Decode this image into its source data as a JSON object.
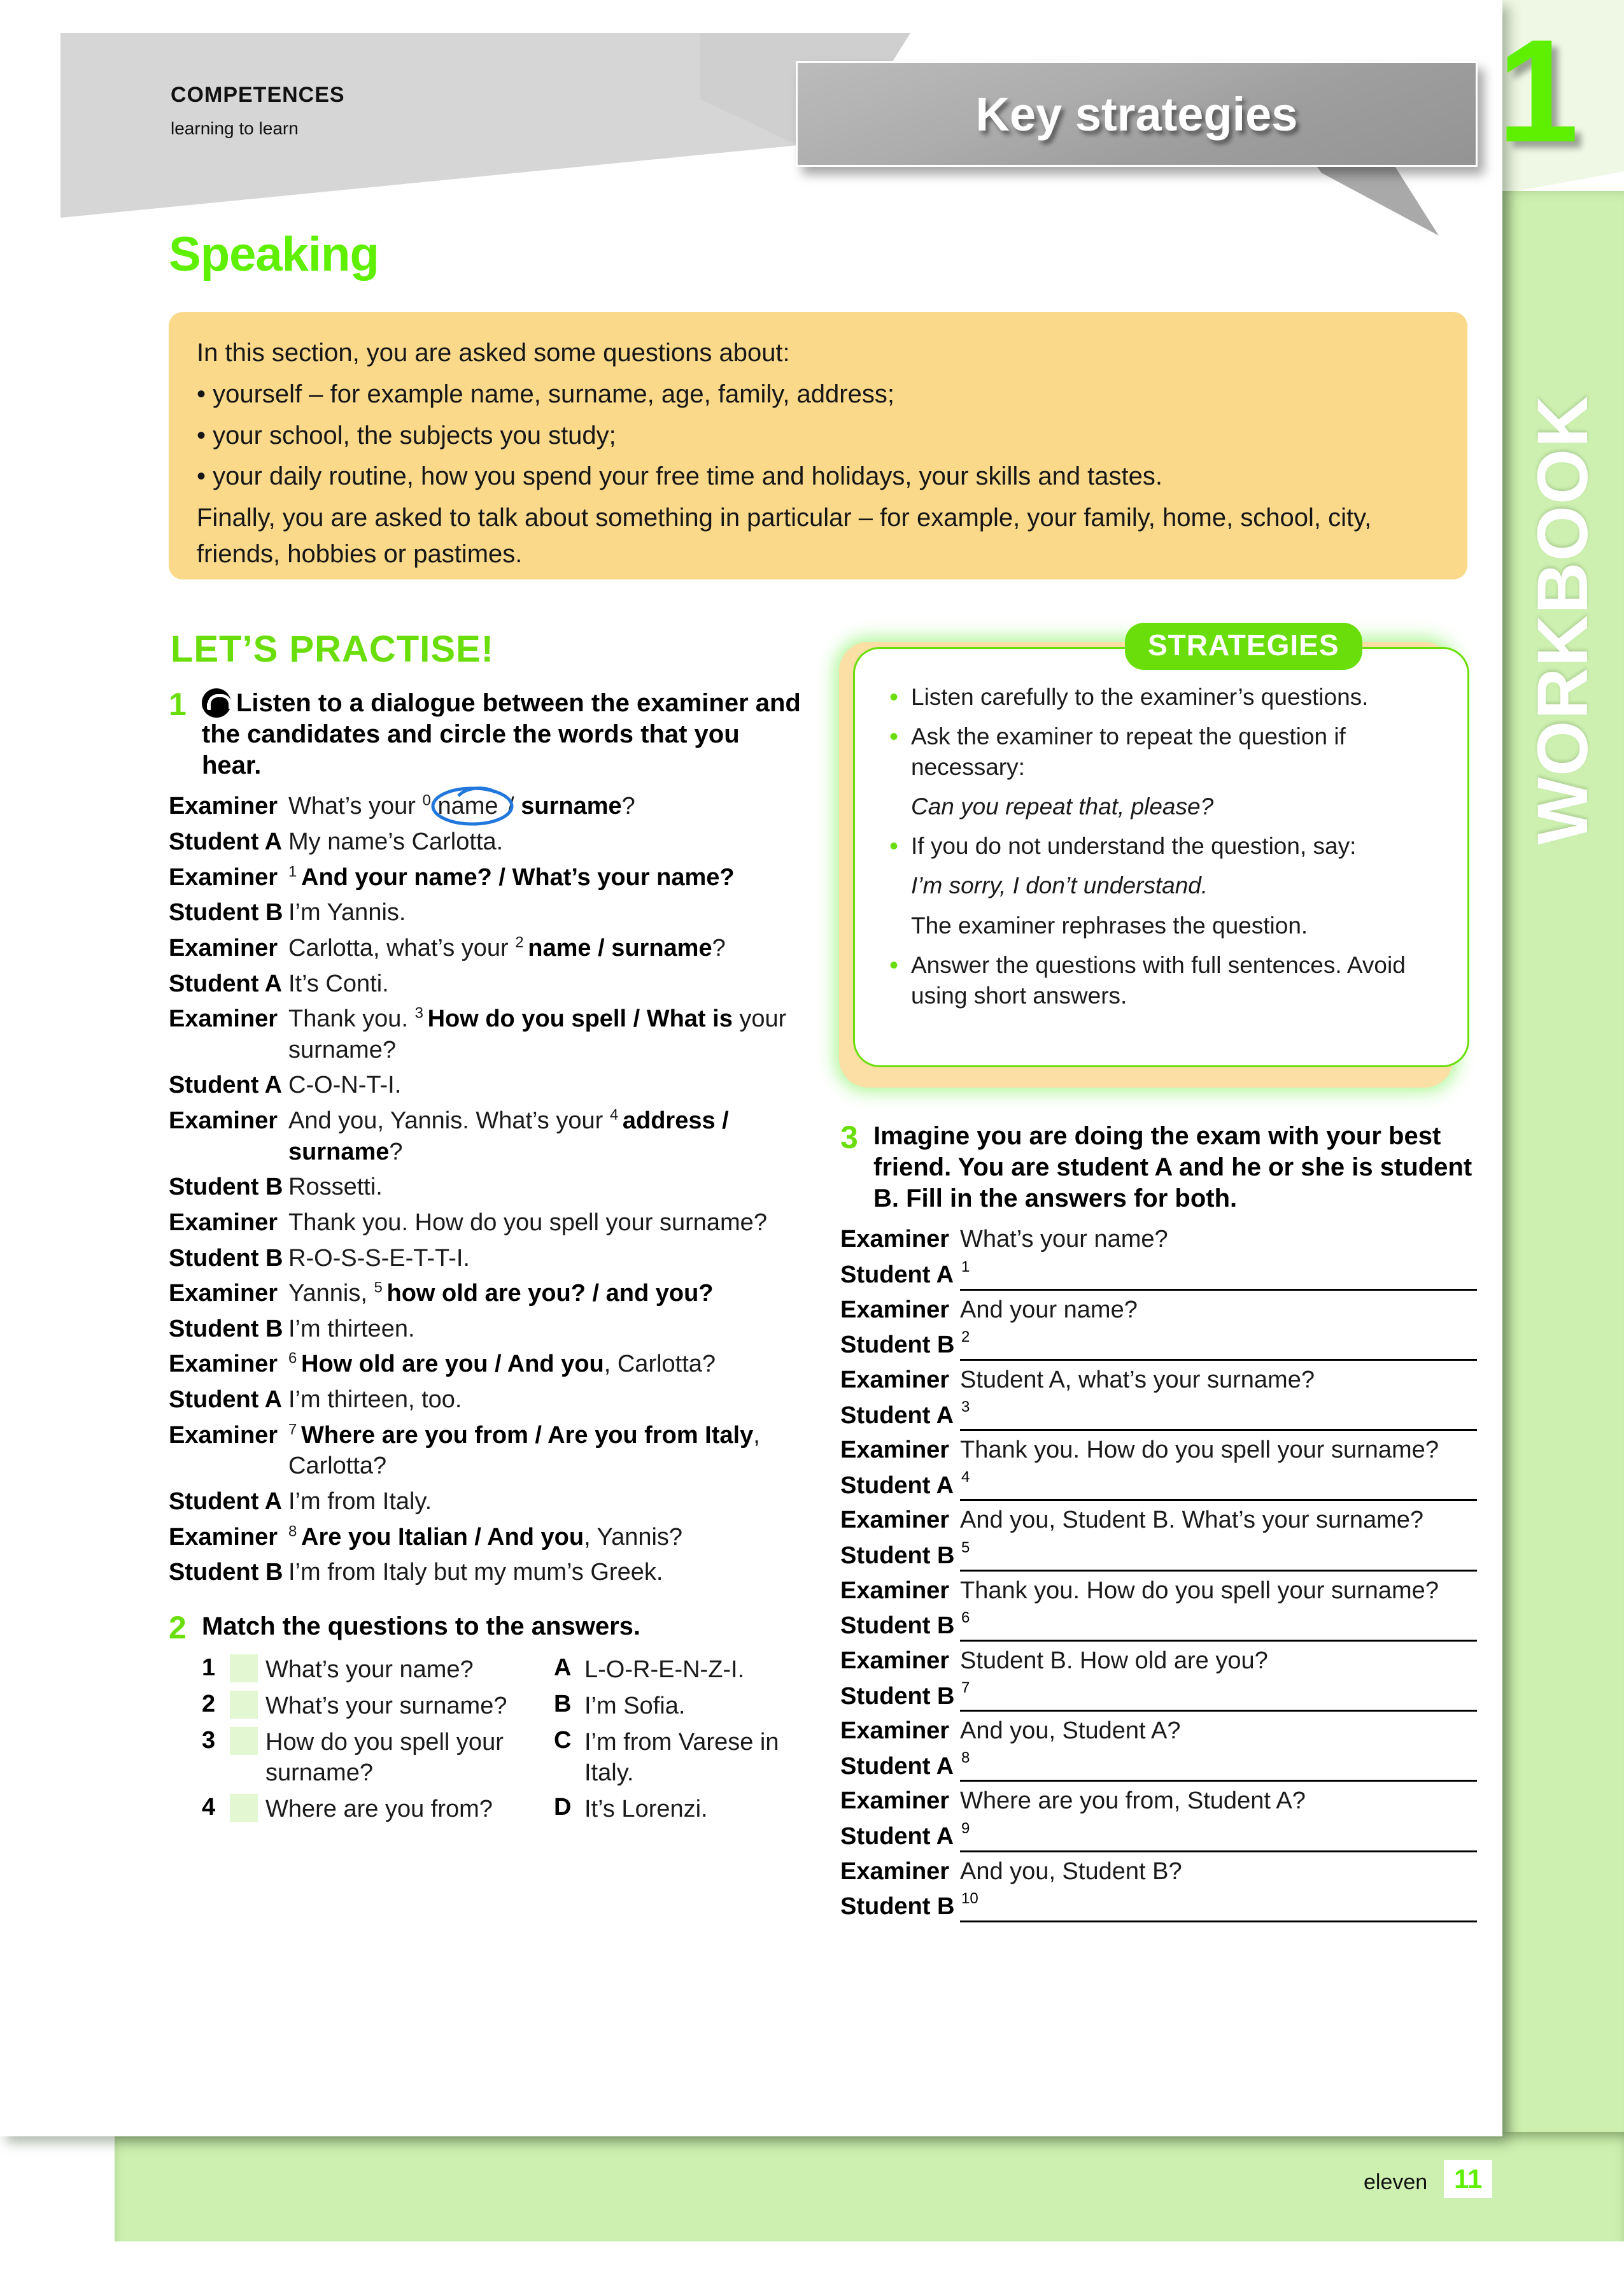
{
  "header": {
    "competences": "COMPETENCES",
    "subtitle": "learning to learn",
    "banner_title": "Key strategies",
    "unit_number": "1",
    "sidebar_label": "WORKBOOK"
  },
  "section": {
    "title": "Speaking",
    "intro": {
      "lead": "In this section, you are asked some questions about:",
      "bullets": [
        "• yourself – for example name, surname, age, family, address;",
        "• your school, the subjects you study;",
        "• your daily routine, how you spend your free time and holidays, your skills and tastes."
      ],
      "closing": "Finally, you are asked to talk about something in particular – for example, your family, home, school, city, friends, hobbies or pastimes."
    },
    "practise_heading": "LET’S PRACTISE!"
  },
  "exercise1": {
    "number": "1",
    "icon": "headphones-icon",
    "instruction": "Listen to a dialogue between the examiner and the candidates and circle the words that you hear.",
    "dialogue": [
      {
        "speaker": "Examiner",
        "parts": [
          {
            "t": "What’s your ",
            "b": false
          },
          {
            "t": "0 ",
            "sup": true
          },
          {
            "t": "name",
            "circled": true
          },
          {
            "t": " / ",
            "b": false
          },
          {
            "t": "surname",
            "b": true
          },
          {
            "t": "?",
            "b": false
          }
        ]
      },
      {
        "speaker": "Student A",
        "parts": [
          {
            "t": "My name’s Carlotta.",
            "b": false
          }
        ]
      },
      {
        "speaker": "Examiner",
        "parts": [
          {
            "t": "1 ",
            "sup": true
          },
          {
            "t": "And your name? / What’s your name?",
            "b": true
          }
        ]
      },
      {
        "speaker": "Student B",
        "parts": [
          {
            "t": "I’m Yannis.",
            "b": false
          }
        ]
      },
      {
        "speaker": "Examiner",
        "parts": [
          {
            "t": "Carlotta, what’s your ",
            "b": false
          },
          {
            "t": "2 ",
            "sup": true
          },
          {
            "t": "name / surname",
            "b": true
          },
          {
            "t": "?",
            "b": false
          }
        ]
      },
      {
        "speaker": "Student A",
        "parts": [
          {
            "t": "It’s Conti.",
            "b": false
          }
        ]
      },
      {
        "speaker": "Examiner",
        "parts": [
          {
            "t": "Thank you. ",
            "b": false
          },
          {
            "t": "3 ",
            "sup": true
          },
          {
            "t": "How do you spell / What is",
            "b": true
          },
          {
            "t": " your surname?",
            "b": false
          }
        ]
      },
      {
        "speaker": "Student A",
        "parts": [
          {
            "t": "C-O-N-T-I.",
            "b": false
          }
        ]
      },
      {
        "speaker": "Examiner",
        "parts": [
          {
            "t": "And you, Yannis. What’s your ",
            "b": false
          },
          {
            "t": "4 ",
            "sup": true
          },
          {
            "t": "address / surname",
            "b": true
          },
          {
            "t": "?",
            "b": false
          }
        ]
      },
      {
        "speaker": "Student B",
        "parts": [
          {
            "t": "Rossetti.",
            "b": false
          }
        ]
      },
      {
        "speaker": "Examiner",
        "parts": [
          {
            "t": "Thank you. How do you spell your surname?",
            "b": false
          }
        ]
      },
      {
        "speaker": "Student B",
        "parts": [
          {
            "t": "R-O-S-S-E-T-T-I.",
            "b": false
          }
        ]
      },
      {
        "speaker": "Examiner",
        "parts": [
          {
            "t": "Yannis, ",
            "b": false
          },
          {
            "t": "5 ",
            "sup": true
          },
          {
            "t": "how old are you? / and you?",
            "b": true
          }
        ]
      },
      {
        "speaker": "Student B",
        "parts": [
          {
            "t": "I’m thirteen.",
            "b": false
          }
        ]
      },
      {
        "speaker": "Examiner",
        "parts": [
          {
            "t": "6 ",
            "sup": true
          },
          {
            "t": "How old are you / And you",
            "b": true
          },
          {
            "t": ", Carlotta?",
            "b": false
          }
        ]
      },
      {
        "speaker": "Student A",
        "parts": [
          {
            "t": "I’m thirteen, too.",
            "b": false
          }
        ]
      },
      {
        "speaker": "Examiner",
        "parts": [
          {
            "t": "7 ",
            "sup": true
          },
          {
            "t": "Where are you from / Are you from Italy",
            "b": true
          },
          {
            "t": ", Carlotta?",
            "b": false
          }
        ]
      },
      {
        "speaker": "Student A",
        "parts": [
          {
            "t": "I’m from Italy.",
            "b": false
          }
        ]
      },
      {
        "speaker": "Examiner",
        "parts": [
          {
            "t": "8 ",
            "sup": true
          },
          {
            "t": "Are you Italian / And you",
            "b": true
          },
          {
            "t": ", Yannis?",
            "b": false
          }
        ]
      },
      {
        "speaker": "Student B",
        "parts": [
          {
            "t": "I’m from Italy but my mum’s Greek.",
            "b": false
          }
        ]
      }
    ]
  },
  "exercise2": {
    "number": "2",
    "instruction": "Match the questions to the answers.",
    "questions": [
      {
        "num": "1",
        "text": "What’s your name?"
      },
      {
        "num": "2",
        "text": "What’s your surname?"
      },
      {
        "num": "3",
        "text": "How do you spell your surname?"
      },
      {
        "num": "4",
        "text": "Where are you from?"
      }
    ],
    "answers": [
      {
        "letter": "A",
        "text": "L-O-R-E-N-Z-I."
      },
      {
        "letter": "B",
        "text": "I’m Sofia."
      },
      {
        "letter": "C",
        "text": "I’m from Varese in Italy."
      },
      {
        "letter": "D",
        "text": "It’s Lorenzi."
      }
    ]
  },
  "strategies": {
    "tag": "STRATEGIES",
    "items": [
      {
        "bullet": true,
        "text": "Listen carefully to the examiner’s questions.",
        "italic": false
      },
      {
        "bullet": true,
        "text": "Ask the examiner to repeat the question if necessary:",
        "italic": false
      },
      {
        "bullet": false,
        "text": "Can you repeat that, please?",
        "italic": true
      },
      {
        "bullet": true,
        "text": "If you do not understand the question, say:",
        "italic": false
      },
      {
        "bullet": false,
        "text": "I’m sorry, I don’t understand.",
        "italic": true
      },
      {
        "bullet": false,
        "text": "The examiner rephrases the question.",
        "italic": false
      },
      {
        "bullet": true,
        "text": "Answer the questions with full sentences. Avoid using short answers.",
        "italic": false
      }
    ]
  },
  "exercise3": {
    "number": "3",
    "instruction": "Imagine you are doing the exam with your best friend. You are student A and he or she is student B. Fill in the answers for both.",
    "rows": [
      {
        "speaker": "Examiner",
        "type": "text",
        "text": "What’s your name?"
      },
      {
        "speaker": "Student A",
        "type": "blank",
        "num": "1"
      },
      {
        "speaker": "Examiner",
        "type": "text",
        "text": "And your name?"
      },
      {
        "speaker": "Student B",
        "type": "blank",
        "num": "2"
      },
      {
        "speaker": "Examiner",
        "type": "text",
        "text": "Student A, what’s your surname?"
      },
      {
        "speaker": "Student A",
        "type": "blank",
        "num": "3"
      },
      {
        "speaker": "Examiner",
        "type": "text",
        "text": "Thank you. How do you spell your surname?"
      },
      {
        "speaker": "Student A",
        "type": "blank",
        "num": "4"
      },
      {
        "speaker": "Examiner",
        "type": "text",
        "text": "And you, Student B. What’s your surname?"
      },
      {
        "speaker": "Student B",
        "type": "blank",
        "num": "5"
      },
      {
        "speaker": "Examiner",
        "type": "text",
        "text": "Thank you. How do you spell your surname?"
      },
      {
        "speaker": "Student B",
        "type": "blank",
        "num": "6"
      },
      {
        "speaker": "Examiner",
        "type": "text",
        "text": "Student B. How old are you?"
      },
      {
        "speaker": "Student B",
        "type": "blank",
        "num": "7"
      },
      {
        "speaker": "Examiner",
        "type": "text",
        "text": "And you, Student A?"
      },
      {
        "speaker": "Student A",
        "type": "blank",
        "num": "8"
      },
      {
        "speaker": "Examiner",
        "type": "text",
        "text": "Where are you from, Student A?"
      },
      {
        "speaker": "Student A",
        "type": "blank",
        "num": "9"
      },
      {
        "speaker": "Examiner",
        "type": "text",
        "text": "And you, Student B?"
      },
      {
        "speaker": "Student B",
        "type": "blank",
        "num": "10"
      }
    ]
  },
  "footer": {
    "word": "eleven",
    "page": "11"
  },
  "colors": {
    "accent_green": "#6ade0a",
    "bright_green": "#5ef000",
    "band_green": "#cdf0b0",
    "pale_green": "#eef8e4",
    "orange_box": "#fad98a",
    "orange_frame": "#fbdfa5",
    "banner_gray": "#d6d6d6",
    "callout_gray": "#a8a8a8",
    "match_box": "#e3f7d2",
    "circle_blue": "#2277dd"
  }
}
